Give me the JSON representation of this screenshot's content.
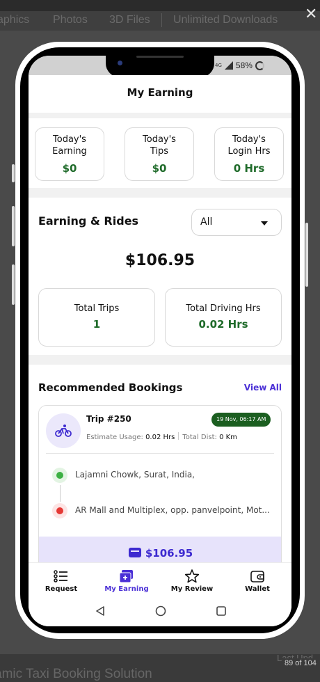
{
  "background": {
    "tabs": [
      "aphics",
      "Photos",
      "3D Files",
      "Unlimited Downloads"
    ],
    "footer_title": "amic Taxi Booking Solution",
    "last_label": "Last Upd",
    "page_counter": "89 of 104",
    "close_label": "✕"
  },
  "status_bar": {
    "network": "4G",
    "battery_text": "58%"
  },
  "header": {
    "title": "My Earning"
  },
  "today_stats": [
    {
      "label": "Today's\nEarning",
      "value": "$0"
    },
    {
      "label": "Today's\nTips",
      "value": "$0"
    },
    {
      "label": "Today's\nLogin Hrs",
      "value": "0 Hrs"
    }
  ],
  "earning_rides": {
    "title": "Earning & Rides",
    "filter_value": "All",
    "total_amount": "$106.95",
    "total_trips_label": "Total Trips",
    "total_trips_value": "1",
    "total_driving_label": "Total Driving Hrs",
    "total_driving_value": "0.02 Hrs"
  },
  "recommended": {
    "title": "Recommended Bookings",
    "view_all": "View All",
    "booking": {
      "trip": "Trip #250",
      "date": "19 Nov, 06:17 AM",
      "usage_label": "Estimate Usage:",
      "usage_value": "0.02 Hrs",
      "dist_label": "Total Dist:",
      "dist_value": "0 Km",
      "pickup": "Lajamni Chowk, Surat, India,",
      "drop": "AR Mall and Multiplex, opp. panvelpoint, Mot...",
      "price": "$106.95"
    }
  },
  "bottom_nav": [
    {
      "label": "Request",
      "icon": "list-icon"
    },
    {
      "label": "My Earning",
      "icon": "earning-icon",
      "active": true
    },
    {
      "label": "My Review",
      "icon": "star-icon"
    },
    {
      "label": "Wallet",
      "icon": "wallet-icon"
    }
  ],
  "colors": {
    "accent": "#4a2fd6",
    "green": "#1f6b2a",
    "badge_green": "#1b5e20",
    "price_bg": "#e7e3fb",
    "pickup_dot": "#3cb043",
    "drop_dot": "#e53935"
  }
}
